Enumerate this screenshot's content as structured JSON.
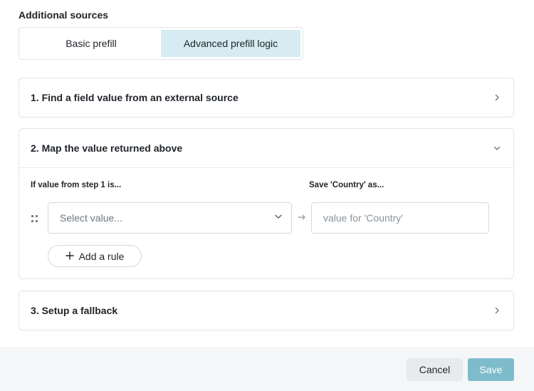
{
  "header": {
    "title": "Additional sources"
  },
  "prefill_tabs": [
    {
      "label": "Basic prefill",
      "active": false
    },
    {
      "label": "Advanced prefill logic",
      "active": true
    }
  ],
  "steps": {
    "step1": {
      "title": "1. Find a field value from an external source",
      "expanded": false
    },
    "step2": {
      "title": "2. Map the value returned above",
      "expanded": true,
      "col_left_label": "If value from step 1 is...",
      "col_right_label": "Save 'Country' as...",
      "select_placeholder": "Select value...",
      "input_placeholder": "value for 'Country'",
      "add_rule_label": "Add a rule"
    },
    "step3": {
      "title": "3. Setup a fallback",
      "expanded": false
    }
  },
  "footer": {
    "cancel_label": "Cancel",
    "save_label": "Save"
  },
  "colors": {
    "accent_active_tab": "#d6ebf2",
    "save_button": "#7fbccb"
  },
  "icons": [
    "chevron-right-icon",
    "chevron-down-icon",
    "drag-handle-icon",
    "arrow-right-icon",
    "plus-icon"
  ]
}
